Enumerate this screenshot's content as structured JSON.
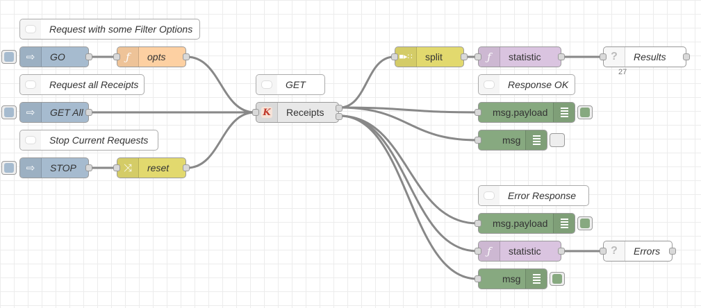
{
  "colors": {
    "inject": "#a6bbcf",
    "function": "#fdd0a2",
    "change": "#e2d96e",
    "split": "#e2d96e",
    "statistic": "#dac4e0",
    "debug": "#87a980",
    "http": "#e8e8e8",
    "comment": "#ffffff",
    "output": "#ffffff",
    "wire": "#888888"
  },
  "nodes": {
    "comment_filter": {
      "label": "Request with some Filter Options",
      "icon": "comment-icon"
    },
    "inject_go": {
      "label": "GO",
      "icon": "arrow-right-icon"
    },
    "fn_opts": {
      "label": "opts",
      "icon": "function-icon"
    },
    "comment_all": {
      "label": "Request all Receipts",
      "icon": "comment-icon"
    },
    "inject_getall": {
      "label": "GET All",
      "icon": "arrow-right-icon"
    },
    "comment_stop": {
      "label": "Stop Current Requests",
      "icon": "comment-icon"
    },
    "inject_stop": {
      "label": "STOP",
      "icon": "arrow-right-icon"
    },
    "change_reset": {
      "label": "reset",
      "icon": "shuffle-icon"
    },
    "comment_get": {
      "label": "GET",
      "icon": "comment-icon"
    },
    "http_receipts": {
      "label": "Receipts",
      "icon": "k-logo-icon"
    },
    "split": {
      "label": "split",
      "icon": "split-icon"
    },
    "stat_ok": {
      "label": "statistic",
      "icon": "function-icon"
    },
    "results": {
      "label": "Results",
      "icon": "question-icon",
      "count": "27"
    },
    "comment_ok": {
      "label": "Response OK",
      "icon": "comment-icon"
    },
    "debug_payload_ok": {
      "label": "msg.payload",
      "icon": "list-icon",
      "active": true
    },
    "debug_msg_ok": {
      "label": "msg",
      "icon": "list-icon",
      "active": false
    },
    "comment_err": {
      "label": "Error Response",
      "icon": "comment-icon"
    },
    "debug_payload_err": {
      "label": "msg.payload",
      "icon": "list-icon",
      "active": true
    },
    "stat_err": {
      "label": "statistic",
      "icon": "function-icon"
    },
    "errors": {
      "label": "Errors",
      "icon": "question-icon"
    },
    "debug_msg_err": {
      "label": "msg",
      "icon": "list-icon",
      "active": true
    }
  },
  "wires": [
    [
      "fn_opts",
      0,
      "http_receipts"
    ],
    [
      "inject_go",
      0,
      "fn_opts"
    ],
    [
      "inject_getall",
      0,
      "http_receipts"
    ],
    [
      "inject_stop",
      0,
      "change_reset"
    ],
    [
      "change_reset",
      0,
      "http_receipts"
    ],
    [
      "http_receipts",
      0,
      "split"
    ],
    [
      "http_receipts",
      0,
      "debug_payload_ok"
    ],
    [
      "http_receipts",
      0,
      "debug_msg_ok"
    ],
    [
      "http_receipts",
      1,
      "debug_payload_err"
    ],
    [
      "http_receipts",
      1,
      "stat_err"
    ],
    [
      "http_receipts",
      1,
      "debug_msg_err"
    ],
    [
      "split",
      0,
      "stat_ok"
    ],
    [
      "stat_ok",
      0,
      "results"
    ],
    [
      "stat_err",
      0,
      "errors"
    ]
  ]
}
